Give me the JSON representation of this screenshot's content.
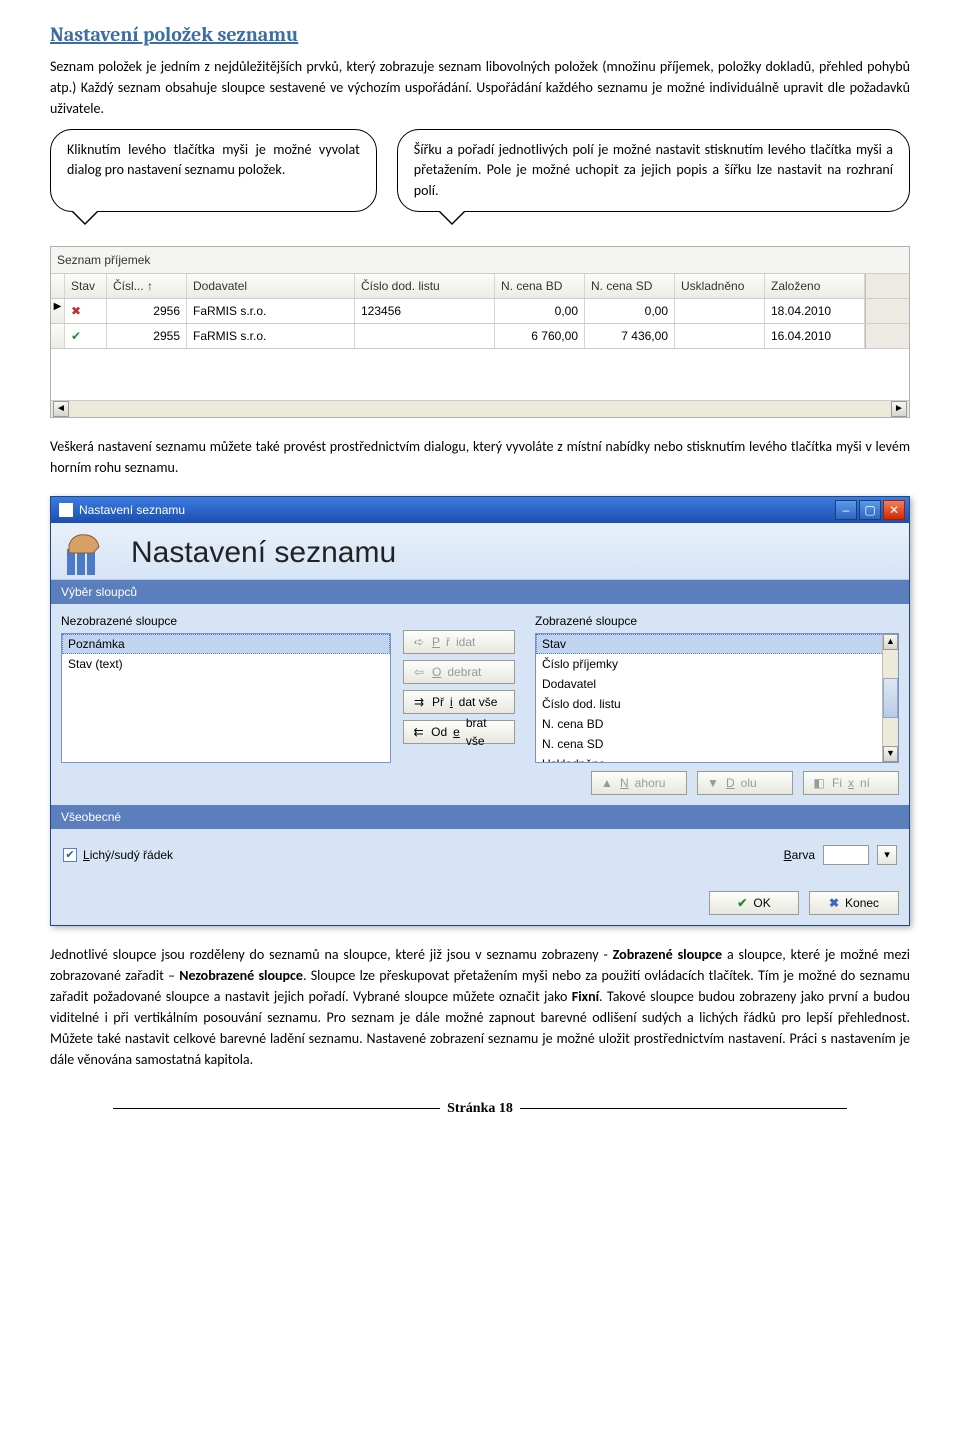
{
  "heading": "Nastavení položek seznamu",
  "p1": "Seznam položek je jedním z nejdůležitějších prvků, který zobrazuje seznam libovolných položek (množinu příjemek, položky dokladů, přehled pohybů atp.) Každý seznam obsahuje sloupce sestavené ve výchozím uspořádání. Uspořádání každého seznamu je možné individuálně upravit dle požadavků uživatele.",
  "callout_left": "Kliknutím levého tlačítka myši je možné vyvolat dialog pro nastavení seznamu položek.",
  "callout_right": "Šířku a pořadí jednotlivých polí je možné nastavit stisknutím levého tlačítka myši a přetažením. Pole je možné uchopit za jejich popis a šířku lze nastavit na rozhraní polí.",
  "grid": {
    "title": "Seznam příjemek",
    "headers": {
      "stav": "Stav",
      "cisl": "Čísl...  ↑",
      "dodavatel": "Dodavatel",
      "cislo_dod": "Číslo dod. listu",
      "ncena_bd": "N. cena BD",
      "ncena_sd": "N. cena SD",
      "uskladneno": "Uskladněno",
      "zalozeno": "Založeno"
    },
    "rows": [
      {
        "cisl": "2956",
        "dod": "FaRMIS s.r.o.",
        "cdl": "123456",
        "nbd": "0,00",
        "nsd": "0,00",
        "usk": "",
        "zal": "18.04.2010"
      },
      {
        "cisl": "2955",
        "dod": "FaRMIS s.r.o.",
        "cdl": "",
        "nbd": "6 760,00",
        "nsd": "7 436,00",
        "usk": "",
        "zal": "16.04.2010"
      }
    ]
  },
  "p2": "Veškerá nastavení seznamu můžete také provést prostřednictvím dialogu, který vyvoláte z místní nabídky nebo stisknutím levého tlačítka myši v levém horním rohu seznamu.",
  "dialog": {
    "title": "Nastavení seznamu",
    "header": "Nastavení seznamu",
    "section_columns": "Výběr sloupců",
    "left_label": "Nezobrazené sloupce",
    "left_items": [
      "Poznámka",
      "Stav (text)"
    ],
    "mid": {
      "pridat": "Přidat",
      "odebrat": "Odebrat",
      "pridat_vse": "Přidat vše",
      "odebrat_vse": "Odebrat vše"
    },
    "right_label": "Zobrazené sloupce",
    "right_items": [
      "Stav",
      "Číslo příjemky",
      "Dodavatel",
      "Číslo dod. listu",
      "N. cena BD",
      "N. cena SD",
      "Uskladněno"
    ],
    "move": {
      "nahoru": "Nahoru",
      "dolu": "Dolu",
      "fixni": "Fixní"
    },
    "section_general": "Všeobecné",
    "odd_even": "Lichý/sudý řádek",
    "barva_label": "Barva",
    "ok": "OK",
    "konec": "Konec"
  },
  "p3a": "Jednotlivé sloupce jsou rozděleny do seznamů na sloupce, které již jsou v seznamu zobrazeny - ",
  "p3b": "Zobrazené sloupce",
  "p3c": " a sloupce, které je možné mezi zobrazované zařadit – ",
  "p3d": "Nezobrazené sloupce",
  "p3e": ". Sloupce lze přeskupovat přetažením myši nebo za použití ovládacích tlačítek. Tím je možné do seznamu zařadit požadované sloupce a nastavit jejich pořadí. Vybrané sloupce můžete označit jako ",
  "p3f": "Fixní",
  "p3g": ". Takové sloupce budou zobrazeny jako první a budou viditelné i při vertikálním posouvání seznamu. Pro seznam je dále možné zapnout barevné odlišení sudých a lichých řádků pro lepší přehlednost. Můžete také nastavit celkové barevné ladění seznamu. Nastavené zobrazení seznamu je možné uložit prostřednictvím nastavení. Práci s nastavením je dále věnována samostatná kapitola.",
  "footer": "Stránka 18"
}
